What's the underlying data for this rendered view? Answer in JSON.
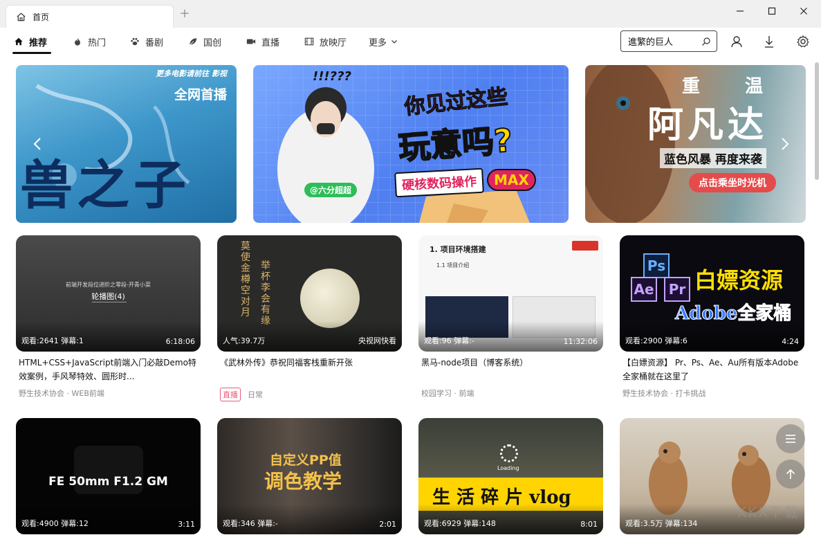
{
  "window": {
    "tab_title": "首页",
    "new_tab": "+"
  },
  "nav": {
    "items": [
      {
        "label": "推荐",
        "icon": "home-icon"
      },
      {
        "label": "热门",
        "icon": "fire-icon"
      },
      {
        "label": "番剧",
        "icon": "paw-icon"
      },
      {
        "label": "国创",
        "icon": "leaf-icon"
      },
      {
        "label": "直播",
        "icon": "video-camera-icon"
      },
      {
        "label": "放映厅",
        "icon": "film-icon"
      },
      {
        "label": "更多",
        "icon": "chevron-down-icon"
      }
    ],
    "active": "推荐"
  },
  "search": {
    "value": "進繁的巨人"
  },
  "banners": [
    {
      "corner_text": "更多电影请前往 影视",
      "headline": "全网首播",
      "title": "兽之子"
    },
    {
      "caption": "!!!???",
      "headline_1": "你见过这些",
      "headline_2": "玩意吗?",
      "tag": "硬核数码操作",
      "tag_max": "MAX",
      "author": "@六分超超"
    },
    {
      "top": "重 温",
      "title": "阿凡达",
      "subtitle": "蓝色风暴 再度来袭",
      "cta": "点击乘坐时光机"
    }
  ],
  "videos": [
    {
      "stats": "观看:2641 弹幕:1",
      "duration": "6:18:06",
      "title": "HTML+CSS+JavaScript前端入门必敲Demo特效案例，手风琴特效、圆形时...",
      "meta": "野生技术协会 · WEB前端",
      "thumb_line1": "前端开发段位进阶之零段-开青小菜",
      "thumb_line2": "轮播图(4)"
    },
    {
      "stats": "人气:39.7万",
      "duration": "央视网快看",
      "title": "《武林外传》恭祝同福客栈重新开张",
      "badge": "直播",
      "meta": "日常",
      "thumb_left": "莫使金樽空对月",
      "thumb_right": "举杯李会有缘"
    },
    {
      "stats": "观看:96 弹幕:-",
      "duration": "11:32:06",
      "title": "黑马-node项目（博客系统）",
      "meta": "校园学习 · 前端",
      "thumb_heading": "1. 项目环境搭建",
      "thumb_sub": "1.1 项目介绍"
    },
    {
      "stats": "观看:2900 弹幕:6",
      "duration": "4:24",
      "title": "【白嫖资源】 Pr、Ps、Ae、Au所有版本Adobe全家桶就在这里了",
      "meta": "野生技术协会 · 打卡挑战",
      "thumb_big": "白嫖资源",
      "thumb_sub": "Adobe全家桶",
      "ps": "Ps",
      "ae": "Ae",
      "pr": "Pr"
    },
    {
      "stats": "观看:4900 弹幕:12",
      "duration": "3:11",
      "thumb_text": "FE 50mm F1.2 GM"
    },
    {
      "stats": "观看:346 弹幕:-",
      "duration": "2:01",
      "thumb_l1": "自定义PP值",
      "thumb_l2": "调色教学"
    },
    {
      "stats": "观看:6929 弹幕:148",
      "duration": "8:01",
      "thumb_text": "生 活 碎 片 vlog",
      "loading": "Loading"
    },
    {
      "stats": "观看:3.5万 弹幕:134",
      "duration": ""
    }
  ],
  "watermark": "KKX下载",
  "colors": {
    "accent": "#111111",
    "live_badge": "#e85a7a",
    "meta": "#888888"
  }
}
